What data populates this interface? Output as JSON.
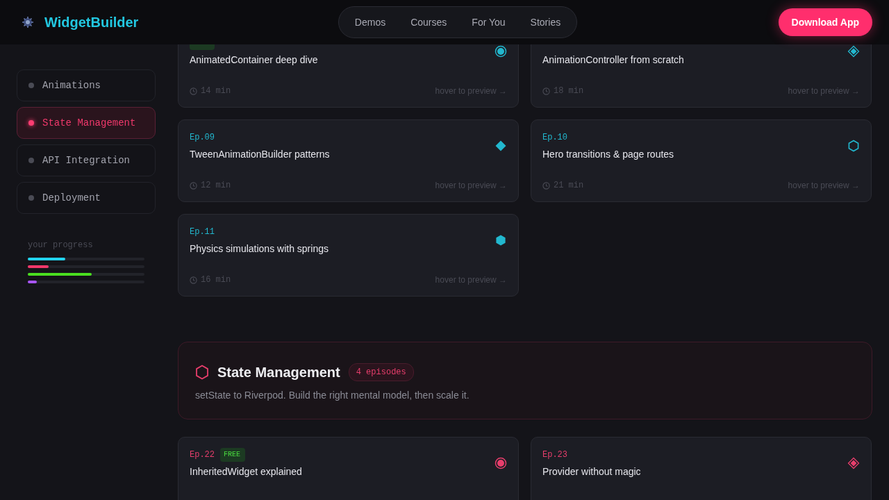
{
  "header": {
    "brand": "WidgetBuilder",
    "nav": [
      {
        "label": "Demos"
      },
      {
        "label": "Courses"
      },
      {
        "label": "For You"
      },
      {
        "label": "Stories"
      }
    ],
    "cta": "Download App"
  },
  "sidebar": {
    "items": [
      {
        "label": "Animations",
        "selected": false
      },
      {
        "label": "State Management",
        "selected": true
      },
      {
        "label": "API Integration",
        "selected": false
      },
      {
        "label": "Deployment",
        "selected": false
      }
    ],
    "progress_label": "your progress",
    "progress": [
      {
        "level": 0.32,
        "color": "#22d3ee"
      },
      {
        "level": 0.18,
        "color": "#f0386b"
      },
      {
        "level": 0.55,
        "color": "#4ade20"
      },
      {
        "level": 0.08,
        "color": "#a855f7"
      }
    ]
  },
  "sections": [
    {
      "color": "#22b8cf",
      "cards": [
        {
          "free": true,
          "title": "AnimatedContainer deep dive",
          "kind": "target",
          "duration": "14 min",
          "hint": "hover to preview →"
        },
        {
          "free": false,
          "title": "AnimationController from scratch",
          "kind": "diamond-ring",
          "duration": "18 min",
          "hint": "hover to preview →"
        },
        {
          "ep": "Ep.09",
          "free": false,
          "title": "TweenAnimationBuilder patterns",
          "kind": "diamond",
          "duration": "12 min",
          "hint": "hover to preview →"
        },
        {
          "ep": "Ep.10",
          "free": false,
          "title": "Hero transitions & page routes",
          "kind": "hexagon",
          "duration": "21 min",
          "hint": "hover to preview →"
        },
        {
          "ep": "Ep.11",
          "free": false,
          "title": "Physics simulations with springs",
          "kind": "hexagon-filled",
          "duration": "16 min",
          "hint": "hover to preview →"
        }
      ]
    },
    {
      "color": "#e83e6c",
      "title": "State Management",
      "count": "4 episodes",
      "description": "setState to Riverpod. Build the right mental model, then scale it.",
      "cards": [
        {
          "ep": "Ep.22",
          "free": true,
          "free_label": "FREE",
          "title": "InheritedWidget explained",
          "kind": "target"
        },
        {
          "ep": "Ep.23",
          "free": false,
          "title": "Provider without magic",
          "kind": "diamond-ring"
        }
      ]
    }
  ]
}
